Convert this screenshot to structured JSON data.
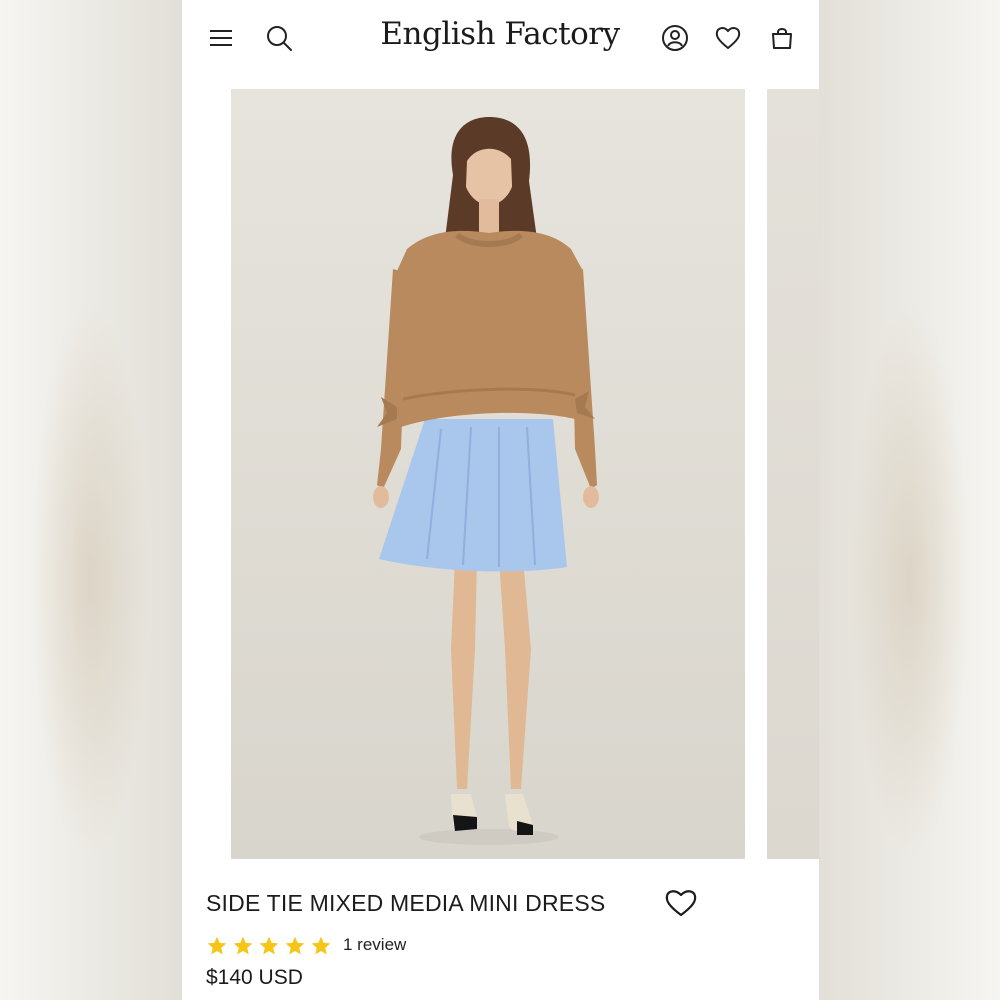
{
  "header": {
    "brand": "English Factory",
    "icons": [
      "menu-icon",
      "search-icon",
      "account-icon",
      "wishlist-icon",
      "cart-icon"
    ]
  },
  "product": {
    "title": "SIDE TIE MIXED MEDIA MINI DRESS",
    "rating": 5,
    "rating_max": 5,
    "review_text": "1 review",
    "price": "$140 USD"
  },
  "colors": {
    "star": "#f5c518",
    "text": "#1c1c1c",
    "photo_bg": "#e2dfd8",
    "sweater": "#b98a5e",
    "skirt": "#a9c6ec"
  }
}
